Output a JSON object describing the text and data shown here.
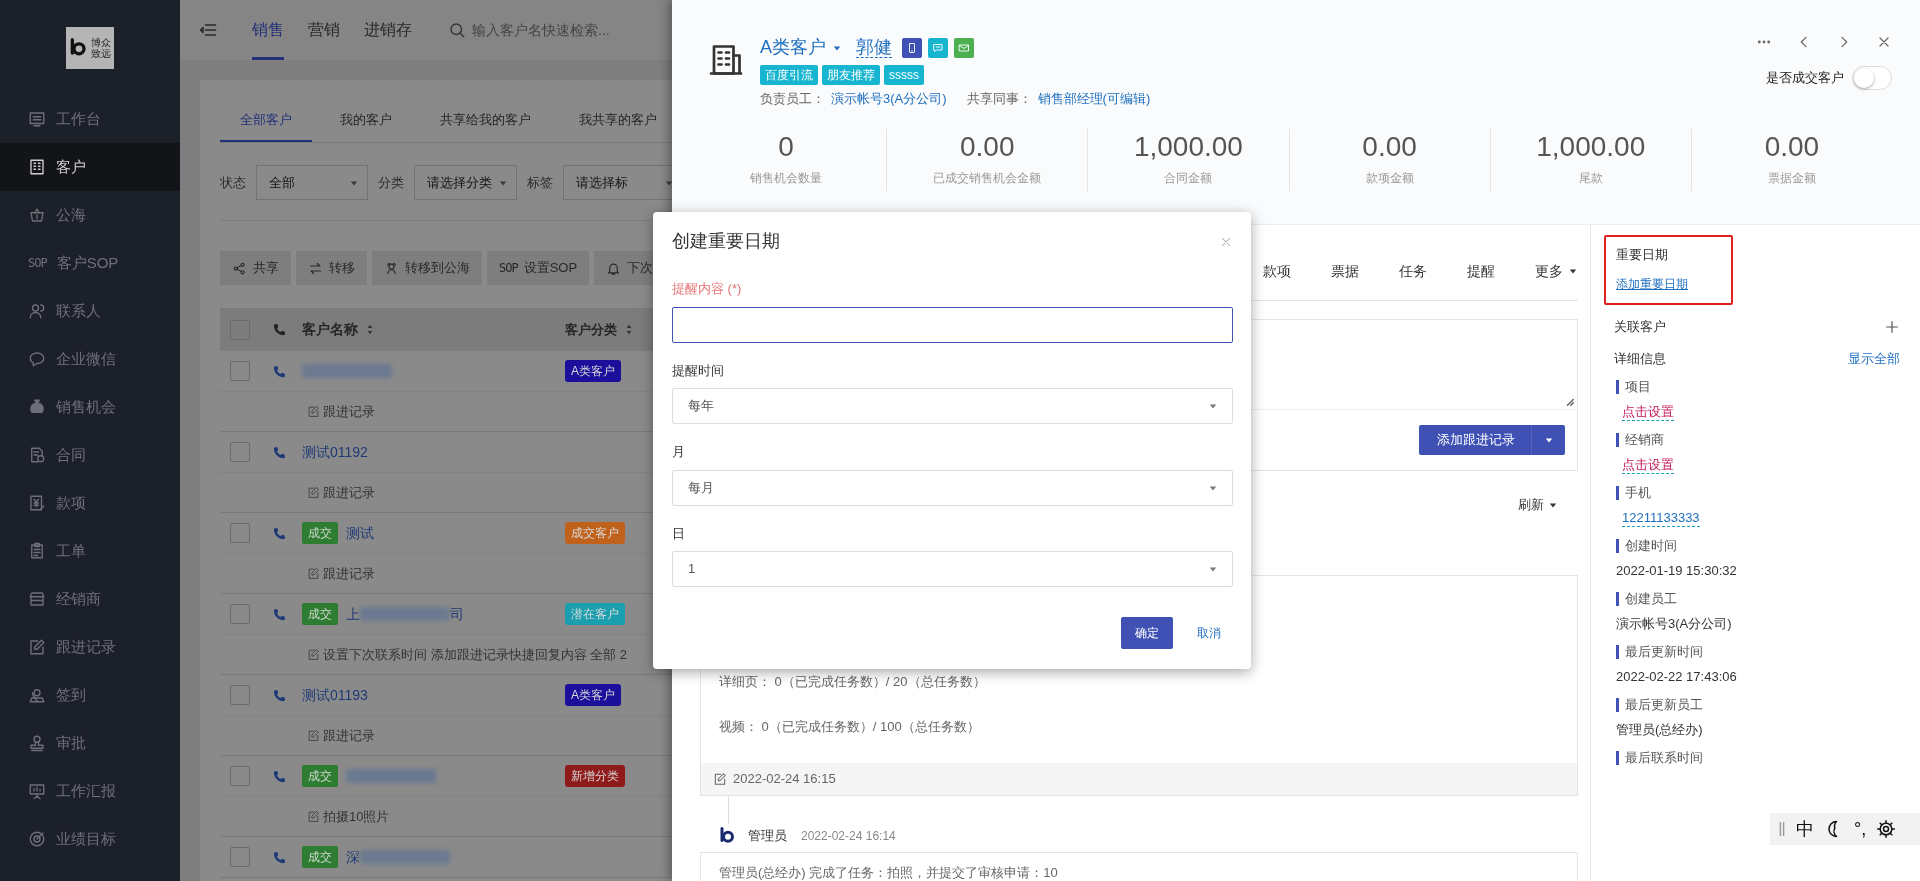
{
  "sidebar": {
    "logo_lines": [
      "博众",
      "致远"
    ],
    "items": [
      {
        "label": "工作台",
        "selected": false
      },
      {
        "label": "客户",
        "selected": true
      },
      {
        "label": "公海",
        "selected": false
      },
      {
        "label": "客户SOP",
        "selected": false,
        "icon_text": "SOP"
      },
      {
        "label": "联系人",
        "selected": false
      },
      {
        "label": "企业微信",
        "selected": false
      },
      {
        "label": "销售机会",
        "selected": false
      },
      {
        "label": "合同",
        "selected": false
      },
      {
        "label": "款项",
        "selected": false
      },
      {
        "label": "工单",
        "selected": false
      },
      {
        "label": "经销商",
        "selected": false
      },
      {
        "label": "跟进记录",
        "selected": false
      },
      {
        "label": "签到",
        "selected": false
      },
      {
        "label": "审批",
        "selected": false
      },
      {
        "label": "工作汇报",
        "selected": false
      },
      {
        "label": "业绩目标",
        "selected": false
      }
    ]
  },
  "topbar": {
    "tabs": [
      {
        "label": "销售",
        "selected": true
      },
      {
        "label": "营销",
        "selected": false
      },
      {
        "label": "进销存",
        "selected": false
      }
    ],
    "search": {
      "placeholder": "输入客户名快速检索..."
    }
  },
  "customer_list": {
    "tabs": [
      {
        "label": "全部客户",
        "selected": true
      },
      {
        "label": "我的客户",
        "selected": false
      },
      {
        "label": "共享给我的客户",
        "selected": false
      },
      {
        "label": "我共享的客户",
        "selected": false
      }
    ],
    "filters": [
      {
        "label": "状态",
        "value": "全部"
      },
      {
        "label": "分类",
        "value": "请选择分类"
      },
      {
        "label": "标签",
        "value": "请选择标"
      }
    ],
    "actions": [
      {
        "label": "共享"
      },
      {
        "label": "转移"
      },
      {
        "label": "转移到公海"
      },
      {
        "label": "设置SOP",
        "icon_text": "SOP"
      },
      {
        "label": "下次"
      }
    ],
    "columns": [
      "客户名称",
      "客户分类"
    ],
    "header_checked": false,
    "rows": [
      {
        "checked": false,
        "blurred": true,
        "category": {
          "label": "A类客户",
          "color": "#1c0f9c"
        },
        "note": "跟进记录"
      },
      {
        "checked": false,
        "blurred": false,
        "name": "测试01192",
        "note": "跟进记录"
      },
      {
        "checked": false,
        "blurred": false,
        "deal_badge": "成交",
        "name": "测试",
        "category": {
          "label": "成交客户",
          "color": "#c0621c"
        },
        "note": "跟进记录"
      },
      {
        "checked": false,
        "blurred": true,
        "deal_badge": "成交",
        "name": "上",
        "name_end": "司",
        "category": {
          "label": "潜在客户",
          "color": "#1b9fae"
        },
        "note": "设置下次联系时间 添加跟进记录快捷回复内容 全部 2"
      },
      {
        "checked": false,
        "blurred": false,
        "name": "测试01193",
        "category": {
          "label": "A类客户",
          "color": "#1c0f9c"
        },
        "note": "跟进记录"
      },
      {
        "checked": false,
        "blurred": true,
        "deal_badge": "成交",
        "category": {
          "label": "新增分类",
          "color": "#8e1a1a"
        },
        "note": "拍摄10照片"
      },
      {
        "checked": false,
        "blurred": true,
        "deal_badge": "成交",
        "name": "深"
      }
    ]
  },
  "drawer": {
    "category": "A类客户",
    "name": "郭健",
    "contact_buttons": [
      {
        "kind": "phone",
        "color": "#3f51b5"
      },
      {
        "kind": "chat",
        "color": "#17b5cf"
      },
      {
        "kind": "mail",
        "color": "#4caf50"
      }
    ],
    "tags": [
      "百度引流",
      "朋友推荐",
      "sssss"
    ],
    "owner_label": "负责员工：",
    "owner": "演示帐号3(A分公司)",
    "shared_label": "共享同事：",
    "shared": "销售部经理(可编辑)",
    "deal_toggle": {
      "label": "是否成交客户",
      "on": false
    },
    "stats": [
      {
        "value": "0",
        "label": "销售机会数量"
      },
      {
        "value": "0.00",
        "label": "已成交销售机会金额"
      },
      {
        "value": "1,000.00",
        "label": "合同金额"
      },
      {
        "value": "0.00",
        "label": "款项金额"
      },
      {
        "value": "1,000.00",
        "label": "尾款"
      },
      {
        "value": "0.00",
        "label": "票据金额"
      }
    ],
    "tabs": [
      {
        "label": "款项",
        "selected": false
      },
      {
        "label": "票据",
        "selected": false
      },
      {
        "label": "任务",
        "selected": false
      },
      {
        "label": "提醒",
        "selected": false
      },
      {
        "label": "更多",
        "selected": false,
        "dropdown": true
      }
    ],
    "add_record_button": "添加跟进记录",
    "refresh": "刷新",
    "timeline": [
      {
        "lines": [
          "详细页： 0（已完成任务数）/ 20（总任务数）",
          "视频： 0（已完成任务数）/ 100（总任务数）"
        ],
        "footer_time": "2022-02-24 16:15"
      },
      {
        "author": "管理员",
        "time": "2022-02-24 16:14",
        "lines": [
          "管理员(总经办) 完成了任务：拍照，并提交了审核申请：10"
        ]
      }
    ],
    "side": {
      "important_dates": {
        "title": "重要日期",
        "link": "添加重要日期",
        "highlighted": true
      },
      "related": {
        "title": "关联客户"
      },
      "details": {
        "title": "详细信息",
        "show_all": "显示全部",
        "fields": [
          {
            "label": "项目",
            "value": "点击设置",
            "kind": "unset"
          },
          {
            "label": "经销商",
            "value": "点击设置",
            "kind": "unset"
          },
          {
            "label": "手机",
            "value": "12211133333",
            "kind": "link"
          },
          {
            "label": "创建时间",
            "value": "2022-01-19 15:30:32",
            "kind": "text"
          },
          {
            "label": "创建员工",
            "value": "演示帐号3(A分公司)",
            "kind": "text"
          },
          {
            "label": "最后更新时间",
            "value": "2022-02-22 17:43:06",
            "kind": "text"
          },
          {
            "label": "最后更新员工",
            "value": "管理员(总经办)",
            "kind": "text"
          },
          {
            "label": "最后联系时间",
            "kind": "text"
          }
        ]
      }
    }
  },
  "dialog": {
    "title": "创建重要日期",
    "fields": [
      {
        "label": "提醒内容 (*)",
        "kind": "input",
        "required": true,
        "focused": true
      },
      {
        "label": "提醒时间",
        "kind": "select",
        "value": "每年"
      },
      {
        "label": "月",
        "kind": "select",
        "value": "每月"
      },
      {
        "label": "日",
        "kind": "select",
        "value": "1"
      }
    ],
    "confirm": "确定",
    "cancel": "取消"
  },
  "ime_bar": {
    "mode": "中",
    "punctuation": "°,"
  }
}
